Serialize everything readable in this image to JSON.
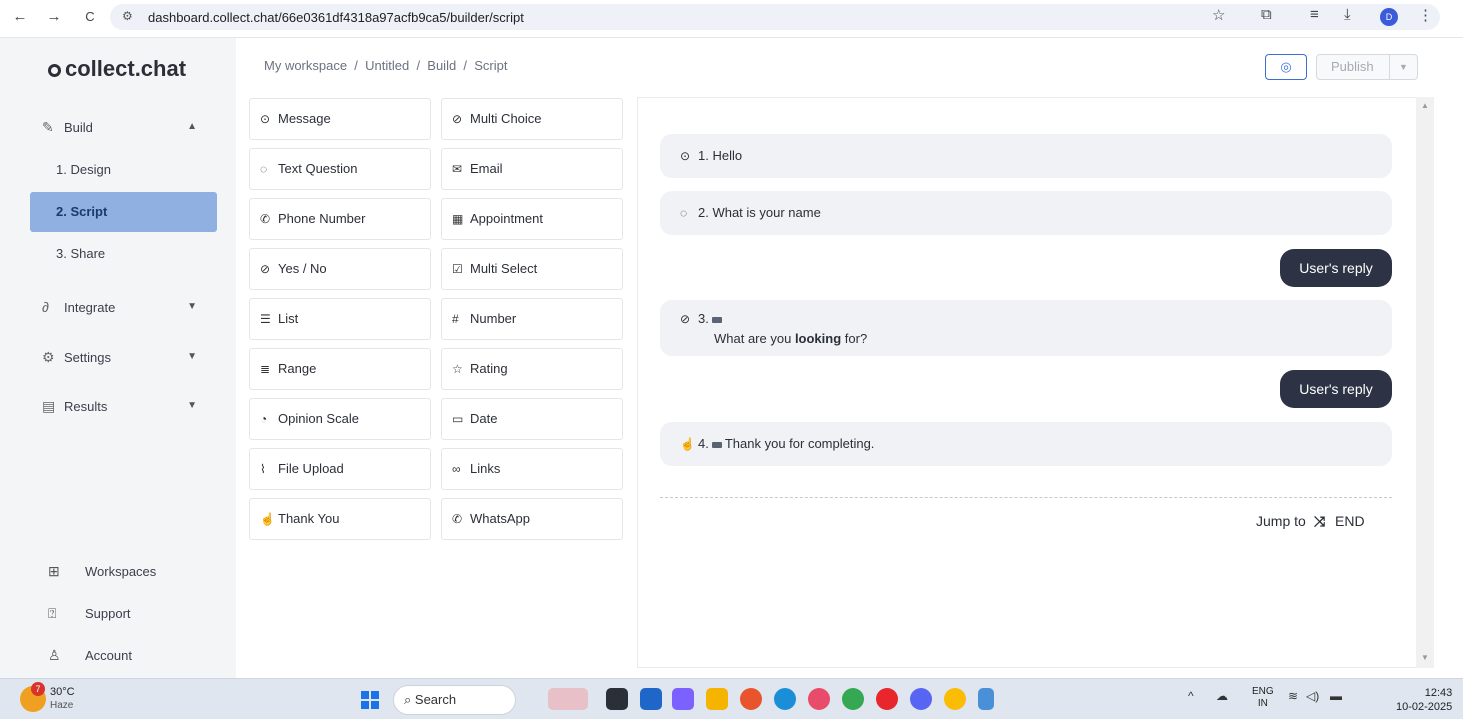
{
  "browser": {
    "back": "←",
    "forward": "→",
    "reload": "C",
    "site_icon": "⚙",
    "url": "dashboard.collect.chat/66e0361df4318a97acfb9ca5/builder/script",
    "star": "☆",
    "extensions": "⧉",
    "queue": "≡",
    "download": "⤓",
    "profile": "D",
    "menu": "⋮"
  },
  "sidebar": {
    "logo": "collect.chat",
    "build": "Build",
    "design": "1. Design",
    "script": "2. Script",
    "share": "3. Share",
    "integrate": "Integrate",
    "settings": "Settings",
    "results": "Results",
    "workspaces": "Workspaces",
    "support": "Support",
    "account": "Account"
  },
  "header": {
    "breadcrumb": "My workspace  /  Untitled  /  Build  /  Script",
    "preview_icon": "◎",
    "publish": "Publish",
    "publish_dd": "▼"
  },
  "tiles": {
    "message": "Message",
    "multi_choice": "Multi Choice",
    "text_question": "Text Question",
    "email": "Email",
    "phone_number": "Phone Number",
    "appointment": "Appointment",
    "yes_no": "Yes / No",
    "multi_select": "Multi Select",
    "list": "List",
    "number": "Number",
    "range": "Range",
    "rating": "Rating",
    "opinion_scale": "Opinion Scale",
    "date": "Date",
    "file_upload": "File Upload",
    "links": "Links",
    "thank_you": "Thank You",
    "whatsapp": "WhatsApp"
  },
  "script": {
    "q1": "1. Hello",
    "q2": "2. What is your name",
    "reply1": "User's reply",
    "q3_num": "3.",
    "q3_text_a": "What are you ",
    "q3_text_b": "looking",
    "q3_text_c": " for?",
    "reply2": "User's reply",
    "q4_num": "4.",
    "q4_text": "Thank you for completing.",
    "jump_label": "Jump to",
    "jump_icon": "⤨",
    "jump_target": "END"
  },
  "taskbar": {
    "weather_count": "7",
    "temp": "30°C",
    "condition": "Haze",
    "search": "Search",
    "lang1": "ENG",
    "lang2": "IN",
    "time": "12:43",
    "date": "10-02-2025"
  },
  "colors": {
    "active_nav": "#8fb0e0",
    "reply_bubble": "#2d3345",
    "accent": "#3b6fd4"
  }
}
